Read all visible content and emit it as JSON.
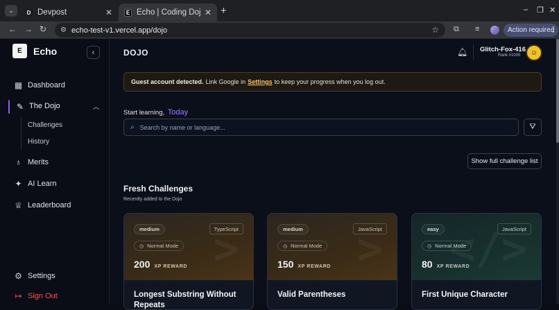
{
  "browser": {
    "tabs": [
      {
        "label": "Devpost",
        "favicon": "D"
      },
      {
        "label": "Echo | Coding Dojo and C",
        "favicon": "E"
      }
    ],
    "url": "echo-test-v1.vercel.app/dojo",
    "action_required": "Action required"
  },
  "sidebar": {
    "logo_mark": "E",
    "app_name": "Echo",
    "items": [
      {
        "label": "Dashboard",
        "icon": "grid-icon"
      },
      {
        "label": "The Dojo",
        "icon": "brush-icon"
      },
      {
        "label": "Merits",
        "icon": "medal-icon"
      },
      {
        "label": "AI Learn",
        "icon": "sparkles-icon"
      },
      {
        "label": "Leaderboard",
        "icon": "trophy-icon"
      }
    ],
    "dojo_sub": [
      "Challenges",
      "History"
    ],
    "settings": "Settings",
    "sign_out": "Sign Out"
  },
  "header": {
    "title": "DOJO",
    "user_name": "Glitch-Fox-416",
    "user_rank": "Rank #1000"
  },
  "banner": {
    "bold": "Guest account detected.",
    "before": "Link Google in",
    "link": "Settings",
    "after": "to keep your progress when you log out."
  },
  "search": {
    "prompt": "Start learning,",
    "highlight": "Today",
    "placeholder": "Search by name or language..."
  },
  "full_list_label": "Show full challenge list",
  "fresh": {
    "title": "Fresh Challenges",
    "subtitle": "Recently added to the Dojo"
  },
  "cards": [
    {
      "difficulty": "medium",
      "language": "TypeScript",
      "mode": "Normal Mode",
      "xp": "200",
      "xp_label": "XP REWARD",
      "title": "Longest Substring Without Repeats",
      "accent": "#3a2b17"
    },
    {
      "difficulty": "medium",
      "language": "JavaScript",
      "mode": "Normal Mode",
      "xp": "150",
      "xp_label": "XP REWARD",
      "title": "Valid Parentheses",
      "accent": "#3a2b17"
    },
    {
      "difficulty": "easy",
      "language": "JavaScript",
      "mode": "Normal Mode",
      "xp": "80",
      "xp_label": "XP REWARD",
      "title": "First Unique Character",
      "accent": "#17302e"
    }
  ]
}
